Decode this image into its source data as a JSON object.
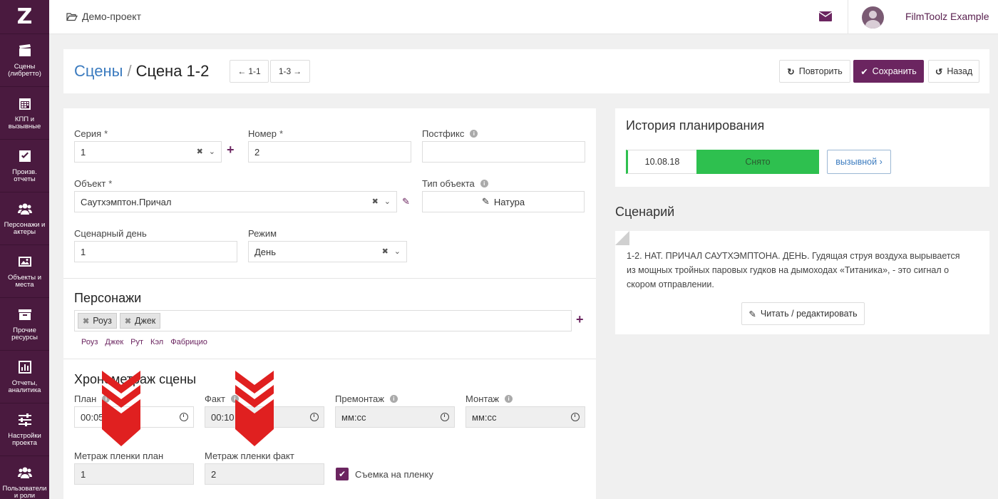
{
  "sidebar": {
    "logo": "Z",
    "items": [
      {
        "label": "Сцены (либретто)",
        "icon": "clapperboard-icon"
      },
      {
        "label": "КПП и вызывные",
        "icon": "calendar-icon"
      },
      {
        "label": "Произв. отчеты",
        "icon": "checkbox-icon"
      },
      {
        "label": "Персонажи и актеры",
        "icon": "users-icon"
      },
      {
        "label": "Объекты и места",
        "icon": "image-icon"
      },
      {
        "label": "Прочие ресурсы",
        "icon": "archive-icon"
      },
      {
        "label": "Отчеты, аналитика",
        "icon": "bar-chart-icon"
      },
      {
        "label": "Настройки проекта",
        "icon": "sliders-icon"
      },
      {
        "label": "Пользователи и роли",
        "icon": "users-icon"
      }
    ]
  },
  "topbar": {
    "project": "Демо-проект",
    "user": "FilmToolz Example"
  },
  "header": {
    "crumb_link": "Сцены",
    "crumb_sep": "/",
    "crumb_current": "Сцена 1-2",
    "prev": "1-1",
    "next": "1-3",
    "repeat": "Повторить",
    "save": "Сохранить",
    "back": "Назад"
  },
  "form": {
    "series_label": "Серия",
    "series_value": "1",
    "number_label": "Номер",
    "number_value": "2",
    "postfix_label": "Постфикс",
    "postfix_value": "",
    "object_label": "Объект",
    "object_value": "Саутхэмптон.Причал",
    "object_type_label": "Тип объекта",
    "object_type_value": "Натура",
    "script_day_label": "Сценарный день",
    "script_day_value": "1",
    "mode_label": "Режим",
    "mode_value": "День",
    "required_mark": "*",
    "characters_title": "Персонажи",
    "characters_selected": [
      "Роуз",
      "Джек"
    ],
    "characters_suggestions": [
      "Роуз",
      "Джек",
      "Рут",
      "Кэл",
      "Фабрицио"
    ],
    "timing_title": "Хронометраж сцены",
    "plan_label": "План",
    "plan_value": "00:05",
    "fact_label": "Факт",
    "fact_value": "00:10",
    "premontage_label": "Премонтаж",
    "premontage_placeholder": "мм:сс",
    "montage_label": "Монтаж",
    "montage_placeholder": "мм:сс",
    "film_plan_label": "Метраж пленки план",
    "film_plan_value": "1",
    "film_fact_label": "Метраж пленки факт",
    "film_fact_value": "2",
    "film_shoot_label": "Съемка на пленку",
    "film_shoot_checked": true
  },
  "history": {
    "title": "История планирования",
    "date": "10.08.18",
    "status": "Снято",
    "status_color": "#2ec04f",
    "call_button": "вызывной"
  },
  "scenario": {
    "title": "Сценарий",
    "text": "1-2. НАТ. ПРИЧАЛ САУТХЭМПТОНА. ДЕНЬ. Гудящая струя воздуха вырывается из мощных тройных паровых гудков на дымоходах «Титаника», - это сигнал о скором отправлении.",
    "edit_button": "Читать / редактировать"
  },
  "colors": {
    "sidebar": "#4a1a3f",
    "accent": "#6b2560",
    "link": "#3b7bbf",
    "annotation_arrow": "#e02020"
  }
}
